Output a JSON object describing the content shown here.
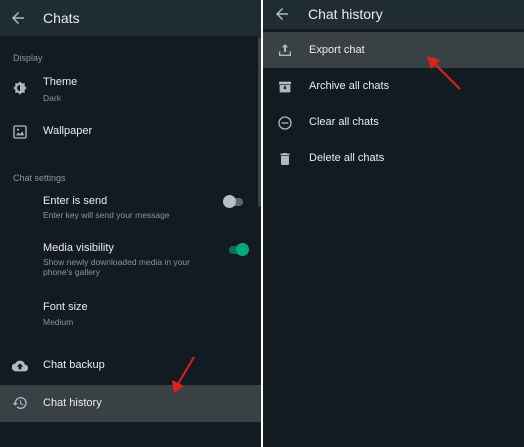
{
  "left": {
    "header": {
      "title": "Chats"
    },
    "display_section": {
      "heading": "Display"
    },
    "theme": {
      "label": "Theme",
      "value": "Dark"
    },
    "wallpaper": {
      "label": "Wallpaper"
    },
    "chat_settings_section": {
      "heading": "Chat settings"
    },
    "enter_is_send": {
      "label": "Enter is send",
      "description": "Enter key will send your message",
      "enabled": false
    },
    "media_visibility": {
      "label": "Media visibility",
      "description_line1": "Show newly downloaded media in your",
      "description_line2": "phone's gallery",
      "enabled": true
    },
    "font_size": {
      "label": "Font size",
      "value": "Medium"
    },
    "chat_backup": {
      "label": "Chat backup"
    },
    "chat_history": {
      "label": "Chat history",
      "selected": true
    }
  },
  "right": {
    "header": {
      "title": "Chat history"
    },
    "items": [
      {
        "label": "Export chat",
        "icon": "share-upload-icon",
        "selected": true
      },
      {
        "label": "Archive all chats",
        "icon": "archive-icon"
      },
      {
        "label": "Clear all chats",
        "icon": "minus-circle-icon"
      },
      {
        "label": "Delete all chats",
        "icon": "trash-icon"
      }
    ]
  },
  "colors": {
    "background": "#121b22",
    "header": "#1f2c34",
    "highlight": "#3a4145",
    "accent": "#00a884",
    "annotation_arrow": "#e0201e"
  }
}
